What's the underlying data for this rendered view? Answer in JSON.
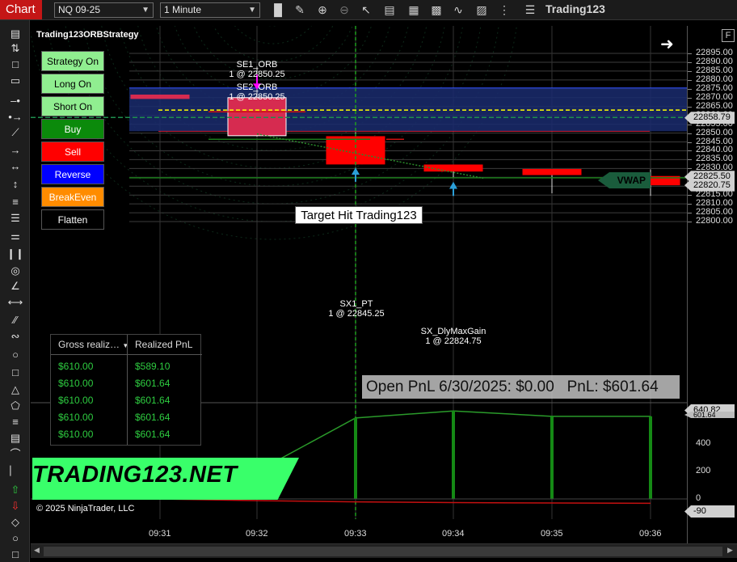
{
  "toolbar": {
    "app_title": "Chart",
    "instrument": "NQ 09-25",
    "interval": "1 Minute",
    "brand": "Trading123",
    "icons": [
      "bar-chart-icon",
      "pencil-icon",
      "zoom-in-icon",
      "zoom-out-icon",
      "pointer-icon",
      "properties-icon",
      "strategies-icon",
      "indicators-icon",
      "templates-icon",
      "add-indicator-icon",
      "rows-icon",
      "menu-icon"
    ]
  },
  "strategy": {
    "name": "Trading123ORBStrategy",
    "buttons": [
      {
        "label": "Strategy On",
        "bg": "#90ee90",
        "fg": "#000000"
      },
      {
        "label": "Long On",
        "bg": "#90ee90",
        "fg": "#000000"
      },
      {
        "label": "Short On",
        "bg": "#90ee90",
        "fg": "#000000"
      },
      {
        "label": "Buy",
        "bg": "#0b8a0b",
        "fg": "#ffffff"
      },
      {
        "label": "Sell",
        "bg": "#ff0000",
        "fg": "#ffffff"
      },
      {
        "label": "Reverse",
        "bg": "#0000ff",
        "fg": "#ffffff"
      },
      {
        "label": "BreakEven",
        "bg": "#ff8c00",
        "fg": "#ffffff"
      },
      {
        "label": "Flatten",
        "bg": "#000000",
        "fg": "#ffffff"
      }
    ]
  },
  "trades": {
    "se1": {
      "name": "SE1_ORB",
      "fill": "1 @ 22850.25"
    },
    "se2": {
      "name": "SE2_ORB",
      "fill": "1 @ 22850.25"
    },
    "sx1": {
      "name": "SX1_PT",
      "fill": "1 @ 22845.25"
    },
    "sx_max": {
      "name": "SX_DlyMaxGain",
      "fill": "1 @ 22824.75"
    }
  },
  "target_hit": "Target Hit Trading123",
  "vwap_label": "VWAP",
  "pnl_banner": {
    "open": "Open PnL 6/30/2025: $0.00",
    "pnl": "PnL: $601.64"
  },
  "pnl_table": {
    "headers": [
      "Gross realiz…",
      "Realized PnL"
    ],
    "rows": [
      [
        "$610.00",
        "$589.10"
      ],
      [
        "$610.00",
        "$601.64"
      ],
      [
        "$610.00",
        "$601.64"
      ],
      [
        "$610.00",
        "$601.64"
      ],
      [
        "$610.00",
        "$601.64"
      ]
    ]
  },
  "watermark": "TRADING123.NET",
  "copyright": "© 2025 NinjaTrader, LLC",
  "price_axis": {
    "labels": [
      "22895.00",
      "22890.00",
      "22885.00",
      "22880.00",
      "22875.00",
      "22870.00",
      "22865.00",
      "22860.00",
      "22855.00",
      "22850.00",
      "22845.00",
      "22840.00",
      "22835.00",
      "22830.00",
      "22825.00",
      "22820.00",
      "22815.00",
      "22810.00",
      "22805.00",
      "22800.00"
    ],
    "tags": {
      "vwap": "22858.79",
      "current": "22825.50",
      "low": "22820.75"
    },
    "button": "F"
  },
  "pnl_axis": {
    "labels": [
      "400",
      "200",
      "0"
    ],
    "tags": {
      "high": "640.82",
      "high2": "601.64",
      "low": "-90"
    }
  },
  "time_axis": [
    "09:31",
    "09:32",
    "09:33",
    "09:34",
    "09:35",
    "09:36"
  ],
  "chart_data": {
    "type": "candlestick",
    "ylim": [
      22797,
      22899
    ],
    "candles": [
      {
        "t": "09:31",
        "o": 22871.5,
        "h": 22871.5,
        "l": 22869.5,
        "c": 22869.5
      },
      {
        "t": "09:32",
        "o": 22870.0,
        "h": 22887.5,
        "l": 22848.0,
        "c": 22848.5
      },
      {
        "t": "09:33",
        "o": 22848.0,
        "h": 22850.5,
        "l": 22832.5,
        "c": 22832.5
      },
      {
        "t": "09:34",
        "o": 22832.0,
        "h": 22832.0,
        "l": 22824.5,
        "c": 22828.5
      },
      {
        "t": "09:35",
        "o": 22829.5,
        "h": 22829.5,
        "l": 22816.0,
        "c": 22826.5
      },
      {
        "t": "09:36",
        "o": 22825.5,
        "h": 22829.5,
        "l": 22814.5,
        "c": 22820.75
      }
    ],
    "bullish_color": "#d62b50",
    "bearish_color": "#ff0000",
    "orb_zone": {
      "high": 22875.5,
      "low": 22851.0,
      "color": "#1a2b6e"
    },
    "vwap": 22858.79,
    "target_line": 22863.0,
    "pnl_series": {
      "x": [
        "09:31",
        "09:32",
        "09:33",
        "09:34",
        "09:35",
        "09:36"
      ],
      "values": [
        0,
        200,
        589,
        640,
        601,
        601
      ]
    },
    "drawdown_series": {
      "x": [
        "09:31",
        "09:32",
        "09:33",
        "09:34",
        "09:35",
        "09:36"
      ],
      "values": [
        0,
        -35,
        -60,
        -75,
        -85,
        -90
      ]
    }
  }
}
